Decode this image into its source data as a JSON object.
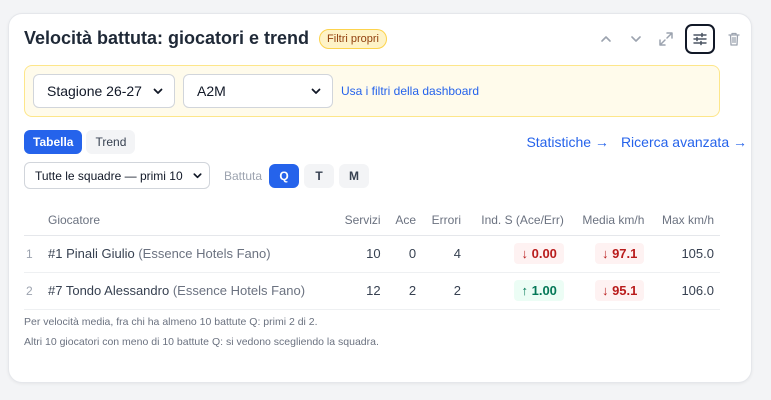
{
  "header": {
    "title": "Velocità battuta: giocatori e trend",
    "badge": "Filtri propri"
  },
  "filters": {
    "season": "Stagione 26-27",
    "league": "A2M",
    "dashboard_link": "Usa i filtri della dashboard"
  },
  "tabs": [
    "Tabella",
    "Trend"
  ],
  "active_tab": "Tabella",
  "links": {
    "stats": "Statistiche →",
    "search": "Ricerca avanzata →"
  },
  "team_select": "Tutte le squadre — primi 10",
  "battuta": {
    "label": "Battuta",
    "options": [
      "Q",
      "T",
      "M"
    ],
    "selected": "Q"
  },
  "table": {
    "columns": [
      "Giocatore",
      "Servizi",
      "Ace",
      "Errori",
      "Ind. S (Ace/Err)",
      "Media km/h",
      "Max km/h"
    ],
    "rows": [
      {
        "idx": "1",
        "name": "#1 Pinali Giulio",
        "club": "(Essence Hotels Fano)",
        "servizi": "10",
        "ace": "0",
        "errori": "4",
        "ind_arrow": "↓",
        "ind": "0.00",
        "ind_dir": "down",
        "media_arrow": "↓",
        "media": "97.1",
        "media_dir": "down",
        "max": "105.0"
      },
      {
        "idx": "2",
        "name": "#7 Tondo Alessandro",
        "club": "(Essence Hotels Fano)",
        "servizi": "12",
        "ace": "2",
        "errori": "2",
        "ind_arrow": "↑",
        "ind": "1.00",
        "ind_dir": "up",
        "media_arrow": "↓",
        "media": "95.1",
        "media_dir": "down",
        "max": "106.0"
      }
    ]
  },
  "footnotes": [
    "Per velocità media, fra chi ha almeno 10 battute Q: primi 2 di 2.",
    "Altri 10 giocatori con meno di 10 battute Q: si vedono scegliendo la squadra."
  ],
  "icons": {
    "up": "chevron-up-icon",
    "down": "chevron-down-icon",
    "expand": "expand-icon",
    "settings": "sliders-icon",
    "delete": "trash-icon"
  }
}
